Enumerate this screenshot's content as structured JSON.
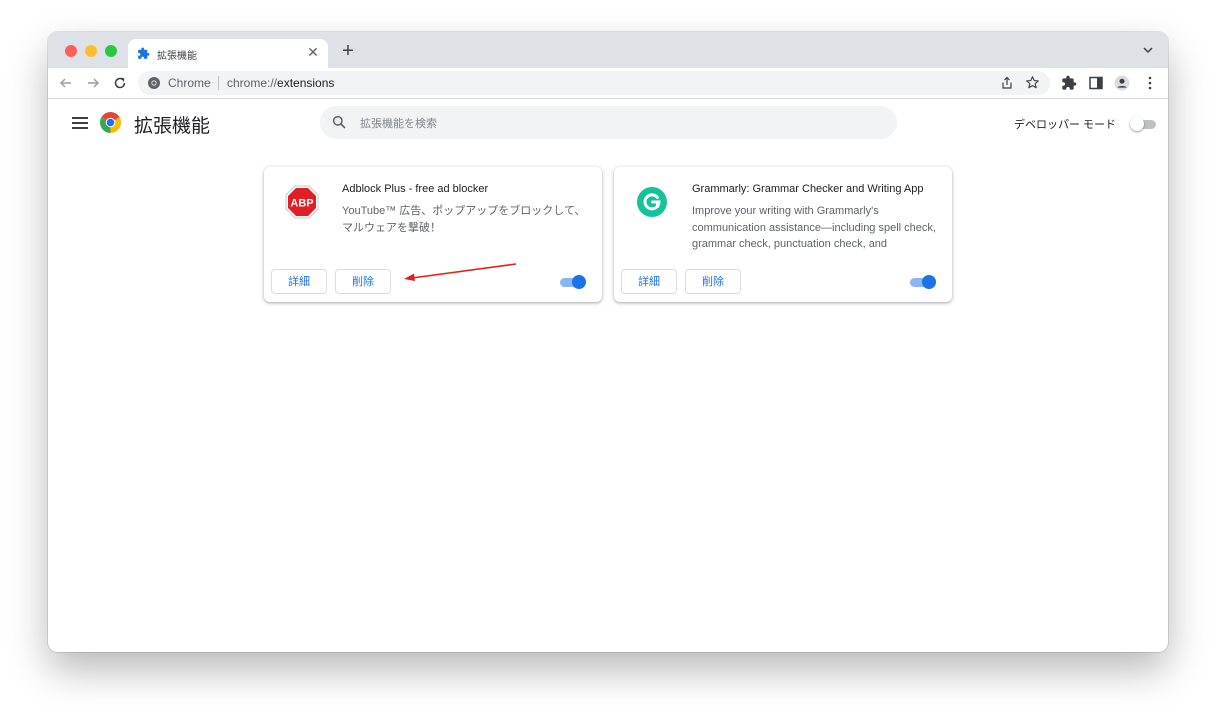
{
  "tab": {
    "title": "拡張機能",
    "icon": "puzzle-icon"
  },
  "omnibox": {
    "site_label": "Chrome",
    "url_scheme": "chrome://",
    "url_path": "extensions"
  },
  "header": {
    "title": "拡張機能",
    "search_placeholder": "拡張機能を検索",
    "dev_mode_label": "デベロッパー モード",
    "dev_mode_on": false
  },
  "extensions": [
    {
      "name": "Adblock Plus - free ad blocker",
      "description": "YouTube™ 広告、ポップアップをブロックして、マルウェアを撃破！",
      "details_label": "詳細",
      "remove_label": "削除",
      "enabled": true,
      "icon": "abp-icon",
      "icon_text": "ABP"
    },
    {
      "name": "Grammarly: Grammar Checker and Writing App",
      "description": "Improve your writing with Grammarly's communication assistance—including spell check, grammar check, punctuation check, and",
      "details_label": "詳細",
      "remove_label": "削除",
      "enabled": true,
      "icon": "grammarly-icon"
    }
  ],
  "colors": {
    "accent": "#1a73e8",
    "toggle_track_on": "#8ab4f8",
    "abp_red": "#e01e25",
    "grammarly_green": "#15c39a",
    "annotation_arrow": "#e02020"
  }
}
